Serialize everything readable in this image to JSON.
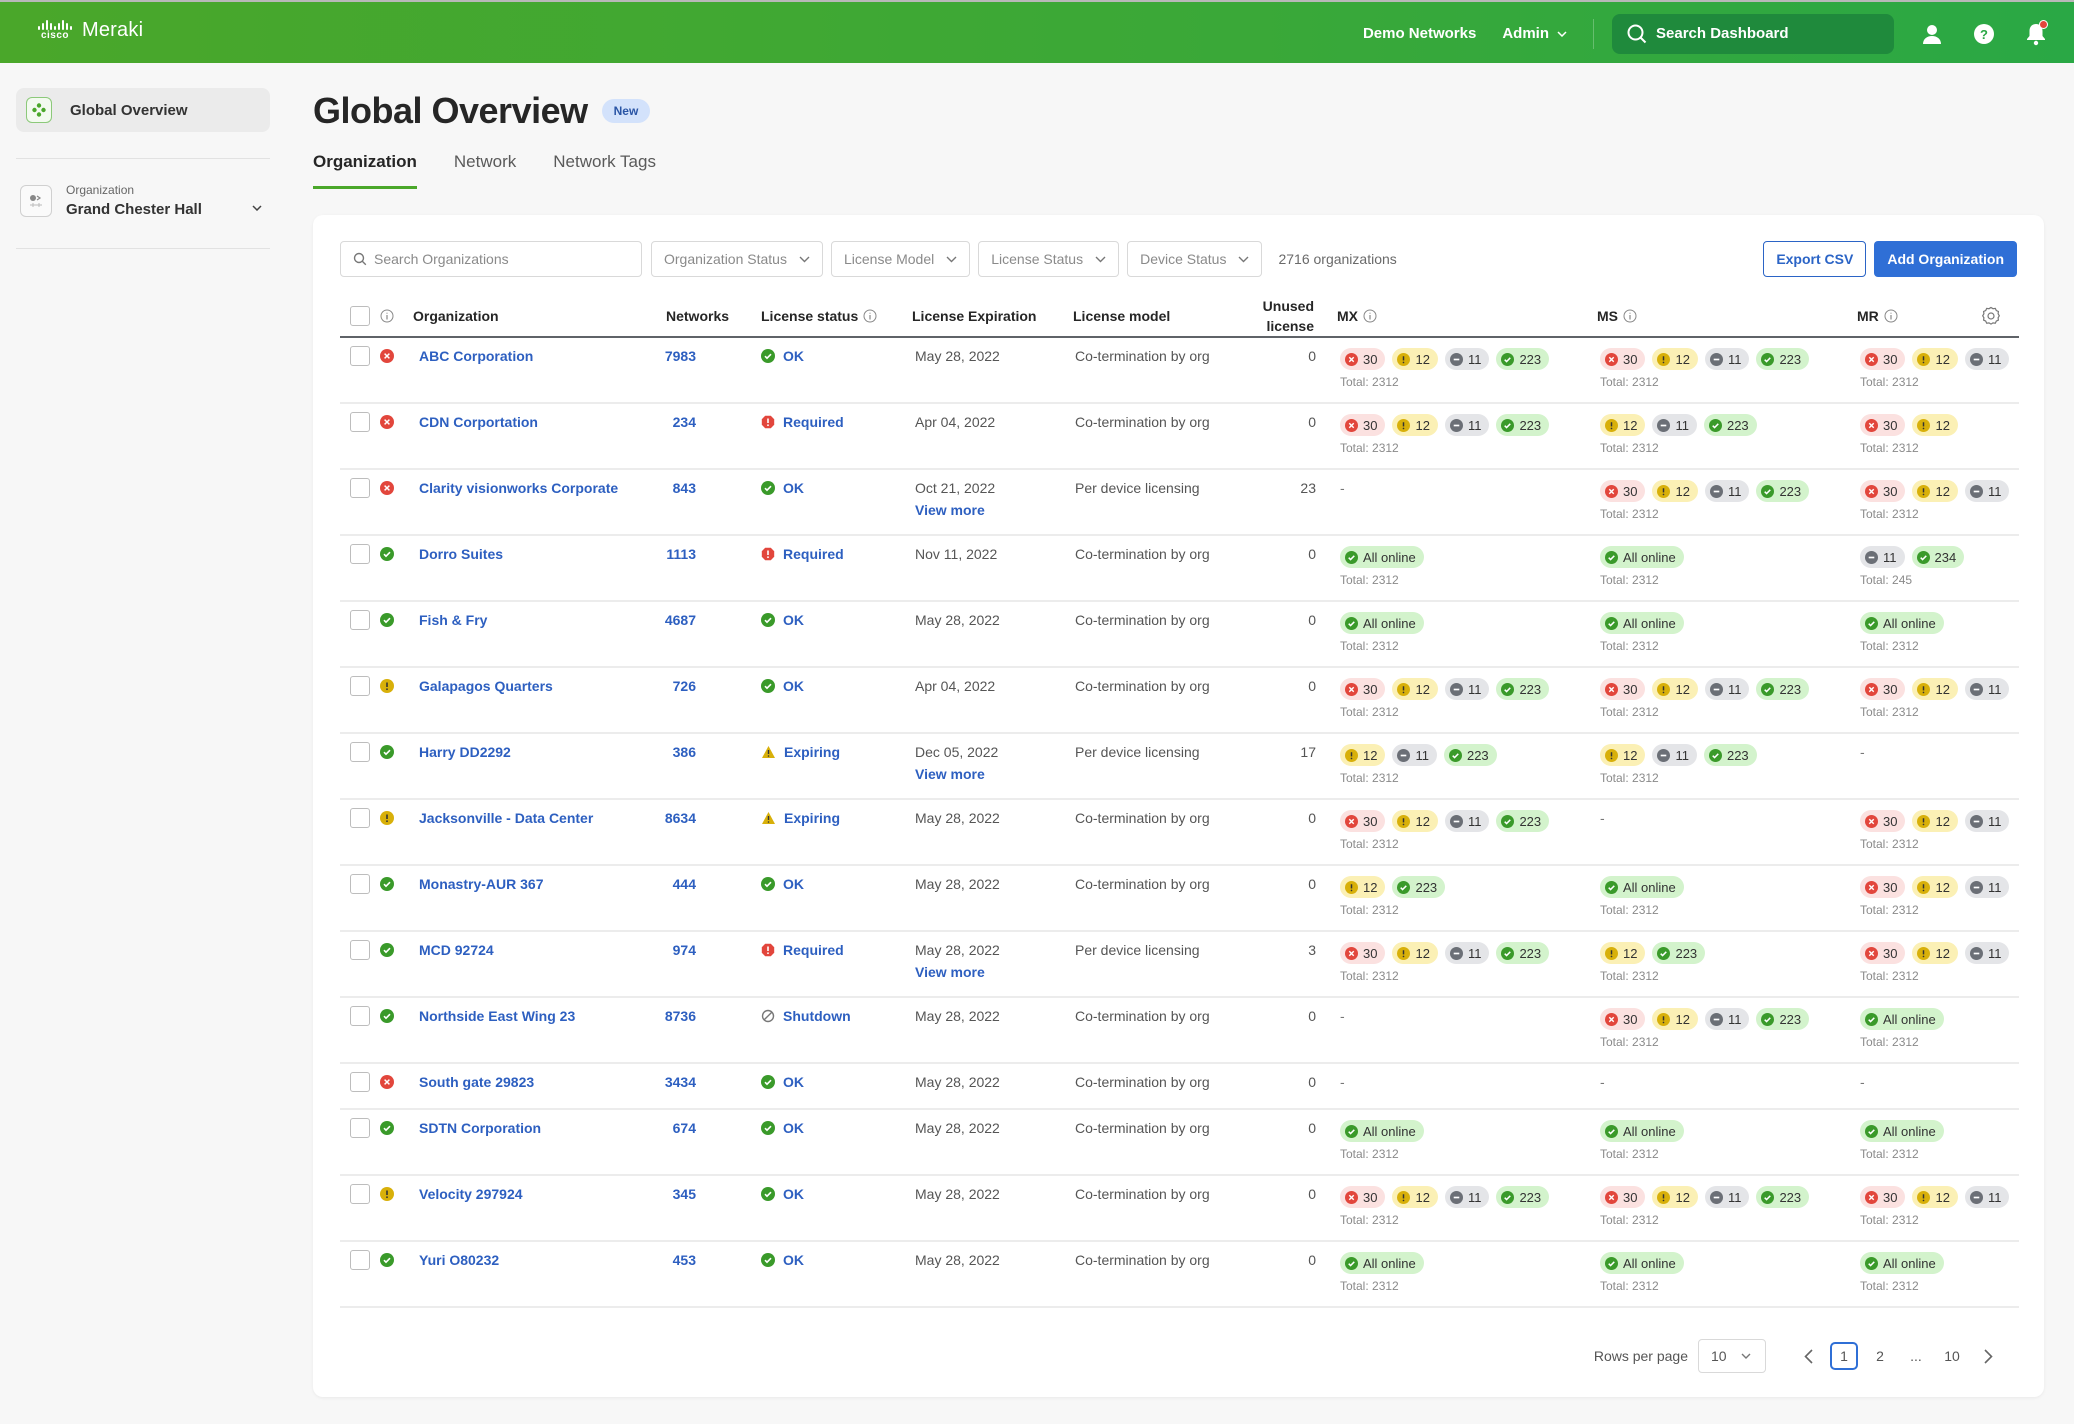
{
  "brand": {
    "cisco": "cisco",
    "product": "Meraki"
  },
  "topbar": {
    "demo_networks": "Demo Networks",
    "admin": "Admin",
    "search_placeholder": "Search Dashboard",
    "icons": [
      "user-icon",
      "help-icon",
      "bell-icon"
    ]
  },
  "sidebar": {
    "active_item": "Global Overview",
    "org_label": "Organization",
    "org_name": "Grand Chester Hall"
  },
  "page": {
    "title": "Global Overview",
    "badge": "New",
    "tabs": [
      {
        "label": "Organization",
        "active": true
      },
      {
        "label": "Network",
        "active": false
      },
      {
        "label": "Network Tags",
        "active": false
      }
    ]
  },
  "toolbar": {
    "search_placeholder": "Search Organizations",
    "filters": [
      "Organization Status",
      "License Model",
      "License Status",
      "Device Status"
    ],
    "count": "2716 organizations",
    "export": "Export CSV",
    "add": "Add Organization"
  },
  "columns": {
    "organization": "Organization",
    "networks": "Networks",
    "license_status": "License status",
    "license_expiration": "License Expiration",
    "license_model": "License model",
    "unused_1": "Unused",
    "unused_2": "license",
    "mx": "MX",
    "ms": "MS",
    "mr": "MR"
  },
  "labels": {
    "total_prefix": "Total: ",
    "view_more": "View more",
    "all_online": "All online"
  },
  "colors": {
    "brand_green": "#4aa72a",
    "link_blue": "#2d5fc0",
    "error": "#e2463c",
    "warning": "#d8b00a",
    "offline": "#6b6f76",
    "ok": "#3a9a2a"
  },
  "rows": [
    {
      "status": "error",
      "name": "ABC Corporation",
      "networks": "7983",
      "license": "OK",
      "license_type": "ok",
      "expiration": "May 28, 2022",
      "view_more": false,
      "model": "Co-termination by org",
      "unused": "0",
      "mx": {
        "pills": [
          [
            "red",
            "30"
          ],
          [
            "yellow",
            "12"
          ],
          [
            "gray",
            "11"
          ],
          [
            "green",
            "223"
          ]
        ],
        "total": "2312"
      },
      "ms": {
        "pills": [
          [
            "red",
            "30"
          ],
          [
            "yellow",
            "12"
          ],
          [
            "gray",
            "11"
          ],
          [
            "green",
            "223"
          ]
        ],
        "total": "2312"
      },
      "mr": {
        "pills": [
          [
            "red",
            "30"
          ],
          [
            "yellow",
            "12"
          ],
          [
            "gray",
            "11"
          ]
        ],
        "total": "2312"
      }
    },
    {
      "status": "error",
      "name": "CDN Corportation",
      "networks": "234",
      "license": "Required",
      "license_type": "required",
      "expiration": "Apr 04, 2022",
      "view_more": false,
      "model": "Co-termination by org",
      "unused": "0",
      "mx": {
        "pills": [
          [
            "red",
            "30"
          ],
          [
            "yellow",
            "12"
          ],
          [
            "gray",
            "11"
          ],
          [
            "green",
            "223"
          ]
        ],
        "total": "2312"
      },
      "ms": {
        "pills": [
          [
            "yellow",
            "12"
          ],
          [
            "gray",
            "11"
          ],
          [
            "green",
            "223"
          ]
        ],
        "total": "2312"
      },
      "mr": {
        "pills": [
          [
            "red",
            "30"
          ],
          [
            "yellow",
            "12"
          ]
        ],
        "total": "2312"
      }
    },
    {
      "status": "error",
      "name": "Clarity visionworks Corporate",
      "networks": "843",
      "license": "OK",
      "license_type": "ok",
      "expiration": "Oct 21, 2022",
      "view_more": true,
      "model": "Per device licensing",
      "unused": "23",
      "mx": null,
      "ms": {
        "pills": [
          [
            "red",
            "30"
          ],
          [
            "yellow",
            "12"
          ],
          [
            "gray",
            "11"
          ],
          [
            "green",
            "223"
          ]
        ],
        "total": "2312"
      },
      "mr": {
        "pills": [
          [
            "red",
            "30"
          ],
          [
            "yellow",
            "12"
          ],
          [
            "gray",
            "11"
          ]
        ],
        "total": "2312"
      }
    },
    {
      "status": "ok",
      "name": "Dorro Suites",
      "networks": "1113",
      "license": "Required",
      "license_type": "required",
      "expiration": "Nov 11, 2022",
      "view_more": false,
      "model": "Co-termination by org",
      "unused": "0",
      "mx": {
        "pills": [
          [
            "green",
            "All online"
          ]
        ],
        "total": "2312"
      },
      "ms": {
        "pills": [
          [
            "green",
            "All online"
          ]
        ],
        "total": "2312"
      },
      "mr": {
        "pills": [
          [
            "gray",
            "11"
          ],
          [
            "green",
            "234"
          ]
        ],
        "total": "245"
      }
    },
    {
      "status": "ok",
      "name": "Fish & Fry",
      "networks": "4687",
      "license": "OK",
      "license_type": "ok",
      "expiration": "May 28, 2022",
      "view_more": false,
      "model": "Co-termination by org",
      "unused": "0",
      "mx": {
        "pills": [
          [
            "green",
            "All online"
          ]
        ],
        "total": "2312"
      },
      "ms": {
        "pills": [
          [
            "green",
            "All online"
          ]
        ],
        "total": "2312"
      },
      "mr": {
        "pills": [
          [
            "green",
            "All online"
          ]
        ],
        "total": "2312"
      }
    },
    {
      "status": "warning",
      "name": "Galapagos Quarters",
      "networks": "726",
      "license": "OK",
      "license_type": "ok",
      "expiration": "Apr 04, 2022",
      "view_more": false,
      "model": "Co-termination by org",
      "unused": "0",
      "mx": {
        "pills": [
          [
            "red",
            "30"
          ],
          [
            "yellow",
            "12"
          ],
          [
            "gray",
            "11"
          ],
          [
            "green",
            "223"
          ]
        ],
        "total": "2312"
      },
      "ms": {
        "pills": [
          [
            "red",
            "30"
          ],
          [
            "yellow",
            "12"
          ],
          [
            "gray",
            "11"
          ],
          [
            "green",
            "223"
          ]
        ],
        "total": "2312"
      },
      "mr": {
        "pills": [
          [
            "red",
            "30"
          ],
          [
            "yellow",
            "12"
          ],
          [
            "gray",
            "11"
          ]
        ],
        "total": "2312"
      }
    },
    {
      "status": "ok",
      "name": "Harry DD2292",
      "networks": "386",
      "license": "Expiring",
      "license_type": "expiring",
      "expiration": "Dec 05, 2022",
      "view_more": true,
      "model": "Per device licensing",
      "unused": "17",
      "mx": {
        "pills": [
          [
            "yellow",
            "12"
          ],
          [
            "gray",
            "11"
          ],
          [
            "green",
            "223"
          ]
        ],
        "total": "2312"
      },
      "ms": {
        "pills": [
          [
            "yellow",
            "12"
          ],
          [
            "gray",
            "11"
          ],
          [
            "green",
            "223"
          ]
        ],
        "total": "2312"
      },
      "mr": null
    },
    {
      "status": "warning",
      "name": "Jacksonville - Data Center",
      "networks": "8634",
      "license": "Expiring",
      "license_type": "expiring",
      "expiration": "May 28, 2022",
      "view_more": false,
      "model": "Co-termination by org",
      "unused": "0",
      "mx": {
        "pills": [
          [
            "red",
            "30"
          ],
          [
            "yellow",
            "12"
          ],
          [
            "gray",
            "11"
          ],
          [
            "green",
            "223"
          ]
        ],
        "total": "2312"
      },
      "ms": null,
      "mr": {
        "pills": [
          [
            "red",
            "30"
          ],
          [
            "yellow",
            "12"
          ],
          [
            "gray",
            "11"
          ]
        ],
        "total": "2312"
      }
    },
    {
      "status": "ok",
      "name": "Monastry-AUR 367",
      "networks": "444",
      "license": "OK",
      "license_type": "ok",
      "expiration": "May 28, 2022",
      "view_more": false,
      "model": "Co-termination by org",
      "unused": "0",
      "mx": {
        "pills": [
          [
            "yellow",
            "12"
          ],
          [
            "green",
            "223"
          ]
        ],
        "total": "2312"
      },
      "ms": {
        "pills": [
          [
            "green",
            "All online"
          ]
        ],
        "total": "2312"
      },
      "mr": {
        "pills": [
          [
            "red",
            "30"
          ],
          [
            "yellow",
            "12"
          ],
          [
            "gray",
            "11"
          ]
        ],
        "total": "2312"
      }
    },
    {
      "status": "ok",
      "name": "MCD 92724",
      "networks": "974",
      "license": "Required",
      "license_type": "required",
      "expiration": "May 28, 2022",
      "view_more": true,
      "model": "Per device licensing",
      "unused": "3",
      "mx": {
        "pills": [
          [
            "red",
            "30"
          ],
          [
            "yellow",
            "12"
          ],
          [
            "gray",
            "11"
          ],
          [
            "green",
            "223"
          ]
        ],
        "total": "2312"
      },
      "ms": {
        "pills": [
          [
            "yellow",
            "12"
          ],
          [
            "green",
            "223"
          ]
        ],
        "total": "2312"
      },
      "mr": {
        "pills": [
          [
            "red",
            "30"
          ],
          [
            "yellow",
            "12"
          ],
          [
            "gray",
            "11"
          ]
        ],
        "total": "2312"
      }
    },
    {
      "status": "ok",
      "name": "Northside East Wing 23",
      "networks": "8736",
      "license": "Shutdown",
      "license_type": "shutdown",
      "expiration": "May 28, 2022",
      "view_more": false,
      "model": "Co-termination by org",
      "unused": "0",
      "mx": null,
      "ms": {
        "pills": [
          [
            "red",
            "30"
          ],
          [
            "yellow",
            "12"
          ],
          [
            "gray",
            "11"
          ],
          [
            "green",
            "223"
          ]
        ],
        "total": "2312"
      },
      "mr": {
        "pills": [
          [
            "green",
            "All online"
          ]
        ],
        "total": "2312"
      }
    },
    {
      "status": "error",
      "name": "South gate 29823",
      "networks": "3434",
      "license": "OK",
      "license_type": "ok",
      "expiration": "May 28, 2022",
      "view_more": false,
      "model": "Co-termination by org",
      "unused": "0",
      "mx": null,
      "ms": null,
      "mr": null
    },
    {
      "status": "ok",
      "name": "SDTN Corporation",
      "networks": "674",
      "license": "OK",
      "license_type": "ok",
      "expiration": "May 28, 2022",
      "view_more": false,
      "model": "Co-termination by org",
      "unused": "0",
      "mx": {
        "pills": [
          [
            "green",
            "All online"
          ]
        ],
        "total": "2312"
      },
      "ms": {
        "pills": [
          [
            "green",
            "All online"
          ]
        ],
        "total": "2312"
      },
      "mr": {
        "pills": [
          [
            "green",
            "All online"
          ]
        ],
        "total": "2312"
      }
    },
    {
      "status": "warning",
      "name": "Velocity 297924",
      "networks": "345",
      "license": "OK",
      "license_type": "ok",
      "expiration": "May 28, 2022",
      "view_more": false,
      "model": "Co-termination by org",
      "unused": "0",
      "mx": {
        "pills": [
          [
            "red",
            "30"
          ],
          [
            "yellow",
            "12"
          ],
          [
            "gray",
            "11"
          ],
          [
            "green",
            "223"
          ]
        ],
        "total": "2312"
      },
      "ms": {
        "pills": [
          [
            "red",
            "30"
          ],
          [
            "yellow",
            "12"
          ],
          [
            "gray",
            "11"
          ],
          [
            "green",
            "223"
          ]
        ],
        "total": "2312"
      },
      "mr": {
        "pills": [
          [
            "red",
            "30"
          ],
          [
            "yellow",
            "12"
          ],
          [
            "gray",
            "11"
          ]
        ],
        "total": "2312"
      }
    },
    {
      "status": "ok",
      "name": "Yuri O80232",
      "networks": "453",
      "license": "OK",
      "license_type": "ok",
      "expiration": "May 28, 2022",
      "view_more": false,
      "model": "Co-termination by org",
      "unused": "0",
      "mx": {
        "pills": [
          [
            "green",
            "All online"
          ]
        ],
        "total": "2312"
      },
      "ms": {
        "pills": [
          [
            "green",
            "All online"
          ]
        ],
        "total": "2312"
      },
      "mr": {
        "pills": [
          [
            "green",
            "All online"
          ]
        ],
        "total": "2312"
      }
    }
  ],
  "pagination": {
    "rows_per_page_label": "Rows per page",
    "rows_per_page": "10",
    "pages": [
      "1",
      "2",
      "...",
      "10"
    ],
    "current": "1"
  }
}
